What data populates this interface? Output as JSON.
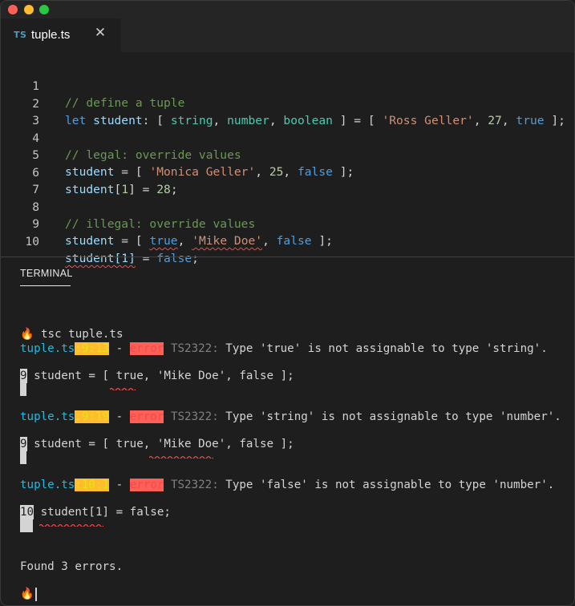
{
  "window": {
    "controls": [
      "close",
      "minimize",
      "zoom"
    ]
  },
  "tab": {
    "lang_badge": "TS",
    "filename": "tuple.ts",
    "close_glyph": "✕"
  },
  "editor": {
    "line_numbers": [
      "1",
      "2",
      "3",
      "4",
      "5",
      "6",
      "7",
      "8",
      "9",
      "10"
    ]
  },
  "terminal": {
    "tab_label": "TERMINAL",
    "prompt_icon": "🔥",
    "command": "tsc tuple.ts",
    "errors": [
      {
        "file": "tuple.ts",
        "loc": ":9:13",
        "sep": " - ",
        "level": "error",
        "code": "TS2322:",
        "message": " Type 'true' is not assignable to type 'string'.",
        "gutter": "9",
        "source": "student = [ true, 'Mike Doe', false ];"
      },
      {
        "file": "tuple.ts",
        "loc": ":9:19",
        "sep": " - ",
        "level": "error",
        "code": "TS2322:",
        "message": " Type 'string' is not assignable to type 'number'.",
        "gutter": "9",
        "source": "student = [ true, 'Mike Doe', false ];"
      },
      {
        "file": "tuple.ts",
        "loc": ":10:1",
        "sep": " - ",
        "level": "error",
        "code": "TS2322:",
        "message": " Type 'false' is not assignable to type 'number'.",
        "gutter": "10",
        "source": "student[1] = false;"
      }
    ],
    "summary": "Found 3 errors."
  },
  "colors": {
    "error": "#f14c4c",
    "filename": "#29b8db",
    "location": "#e5e510",
    "comment": "#6a9955",
    "keyword": "#569cd6",
    "string": "#ce9178",
    "number": "#b5cea8",
    "type": "#4ec9b0"
  },
  "code_tokens": {
    "l1": {
      "comment": "// define a tuple"
    },
    "l2": {
      "kw": "let",
      "var": "student",
      "colon": ": [ ",
      "t1": "string",
      "comma1": ", ",
      "t2": "number",
      "comma2": ", ",
      "t3": "boolean",
      "mid": " ] = [ ",
      "s": "'Ross Geller'",
      "comma3": ", ",
      "n": "27",
      "comma4": ", ",
      "b": "true",
      "end": " ];"
    },
    "l4": {
      "comment": "// legal: override values"
    },
    "l5": {
      "var": "student",
      "mid": " = [ ",
      "s": "'Monica Geller'",
      "comma1": ", ",
      "n": "25",
      "comma2": ", ",
      "b": "false",
      "end": " ];"
    },
    "l6": {
      "var": "student",
      "rest1": "[",
      "n1": "1",
      "rest2": "] = ",
      "n2": "28",
      "end": ";"
    },
    "l8": {
      "comment": "// illegal: override values"
    },
    "l9": {
      "var": "student",
      "mid": " = [ ",
      "b1": "true",
      "comma1": ", ",
      "s": "'Mike Doe'",
      "comma2": ", ",
      "b2": "false",
      "end": " ];"
    },
    "l10": {
      "var": "student[1]",
      "mid": " = ",
      "b": "false",
      "end": ";"
    }
  }
}
